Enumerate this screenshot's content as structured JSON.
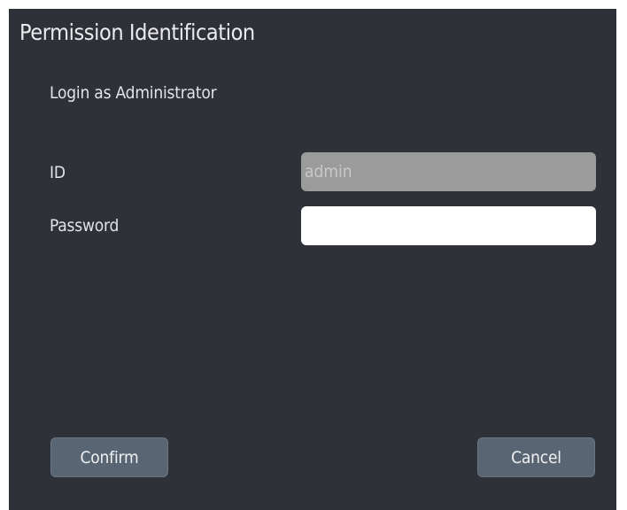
{
  "dialog": {
    "title": "Permission Identification",
    "subtitle": "Login as Administrator",
    "fields": {
      "id": {
        "label": "ID",
        "value": "admin"
      },
      "password": {
        "label": "Password",
        "value": ""
      }
    },
    "buttons": {
      "confirm": "Confirm",
      "cancel": "Cancel"
    }
  },
  "colors": {
    "dialog_background": "#2f3139",
    "text": "#e4e4e6",
    "disabled_input": "#9b9b9c",
    "button": "#5a6573"
  }
}
